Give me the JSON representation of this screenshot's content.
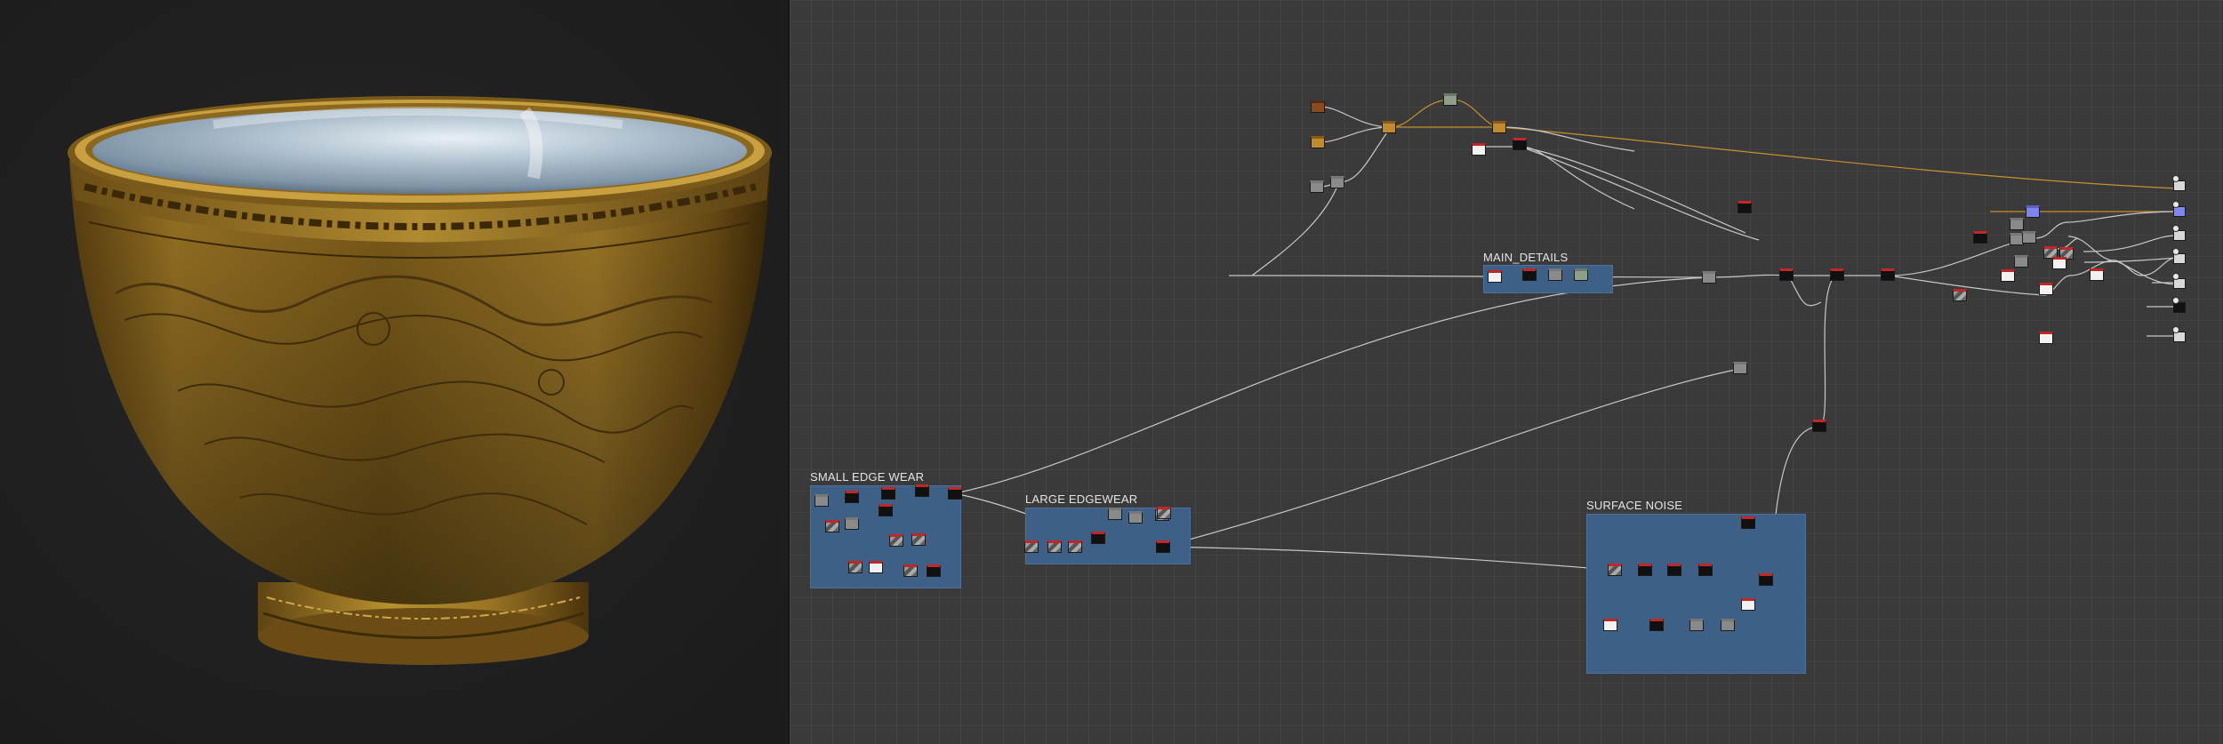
{
  "viewport": {
    "label": "3D view",
    "object": "engraved brass bowl model",
    "colors": {
      "background": "#1e1e1e",
      "brass": "#9a7424",
      "interior": "#b8c8d4"
    }
  },
  "graph": {
    "background": "#3a3a3a",
    "frames": [
      {
        "id": "main-details",
        "title": "MAIN_DETAILS"
      },
      {
        "id": "small-edge-wear",
        "title": "SMALL EDGE WEAR"
      },
      {
        "id": "large-edgewear",
        "title": "LARGE EDGEWEAR"
      },
      {
        "id": "surface-noise",
        "title": "SURFACE NOISE"
      }
    ],
    "frame_color": "#3e5f86",
    "wire_color": "#c8c8c8",
    "accent_wire_color": "#c89030",
    "output_count": 8
  }
}
